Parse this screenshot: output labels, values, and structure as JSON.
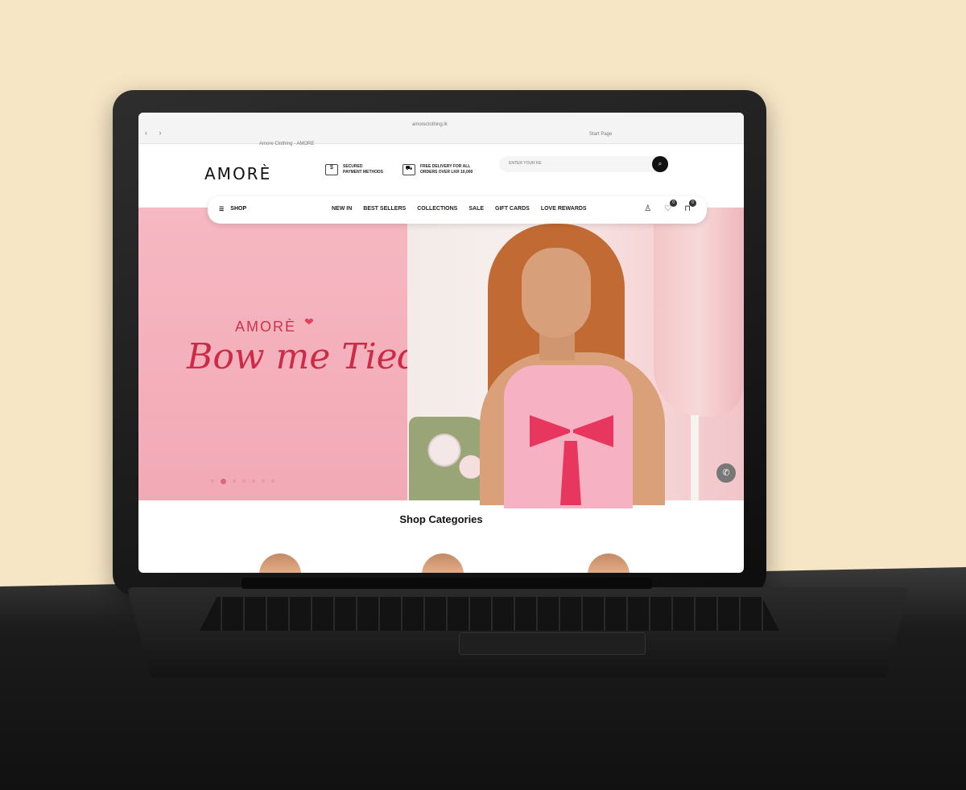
{
  "browser": {
    "url": "amoreclothing.lk",
    "tab_title": "Amore Clothing - AMORE",
    "start_page": "Start Page",
    "nav_glyphs": "‹  ›"
  },
  "header": {
    "logo": "AMORÈ",
    "secured_title": "SECURED",
    "secured_sub": "PAYMENT METHODS",
    "delivery_title": "FREE DELIVERY FOR ALL",
    "delivery_sub": "ORDERS OVER LKR 10,000",
    "search_placeholder": "ENTER YOUR KE",
    "search_icon": "search-icon"
  },
  "nav": {
    "shop_label": "SHOP",
    "links": [
      "NEW IN",
      "BEST SELLERS",
      "COLLECTIONS",
      "SALE",
      "GIFT CARDS",
      "LOVE REWARDS"
    ],
    "wishlist_count": "0",
    "cart_count": "0"
  },
  "hero": {
    "brand": "AMORÈ",
    "headline": "Bow me Tied",
    "slide_count": 7,
    "active_slide": 2
  },
  "sections": {
    "categories_title": "Shop Categories"
  },
  "colors": {
    "hero_pink": "#f4b0bc",
    "brand_red": "#cc2a45",
    "bow_red": "#e8375f",
    "background": "#f7e6c6"
  }
}
